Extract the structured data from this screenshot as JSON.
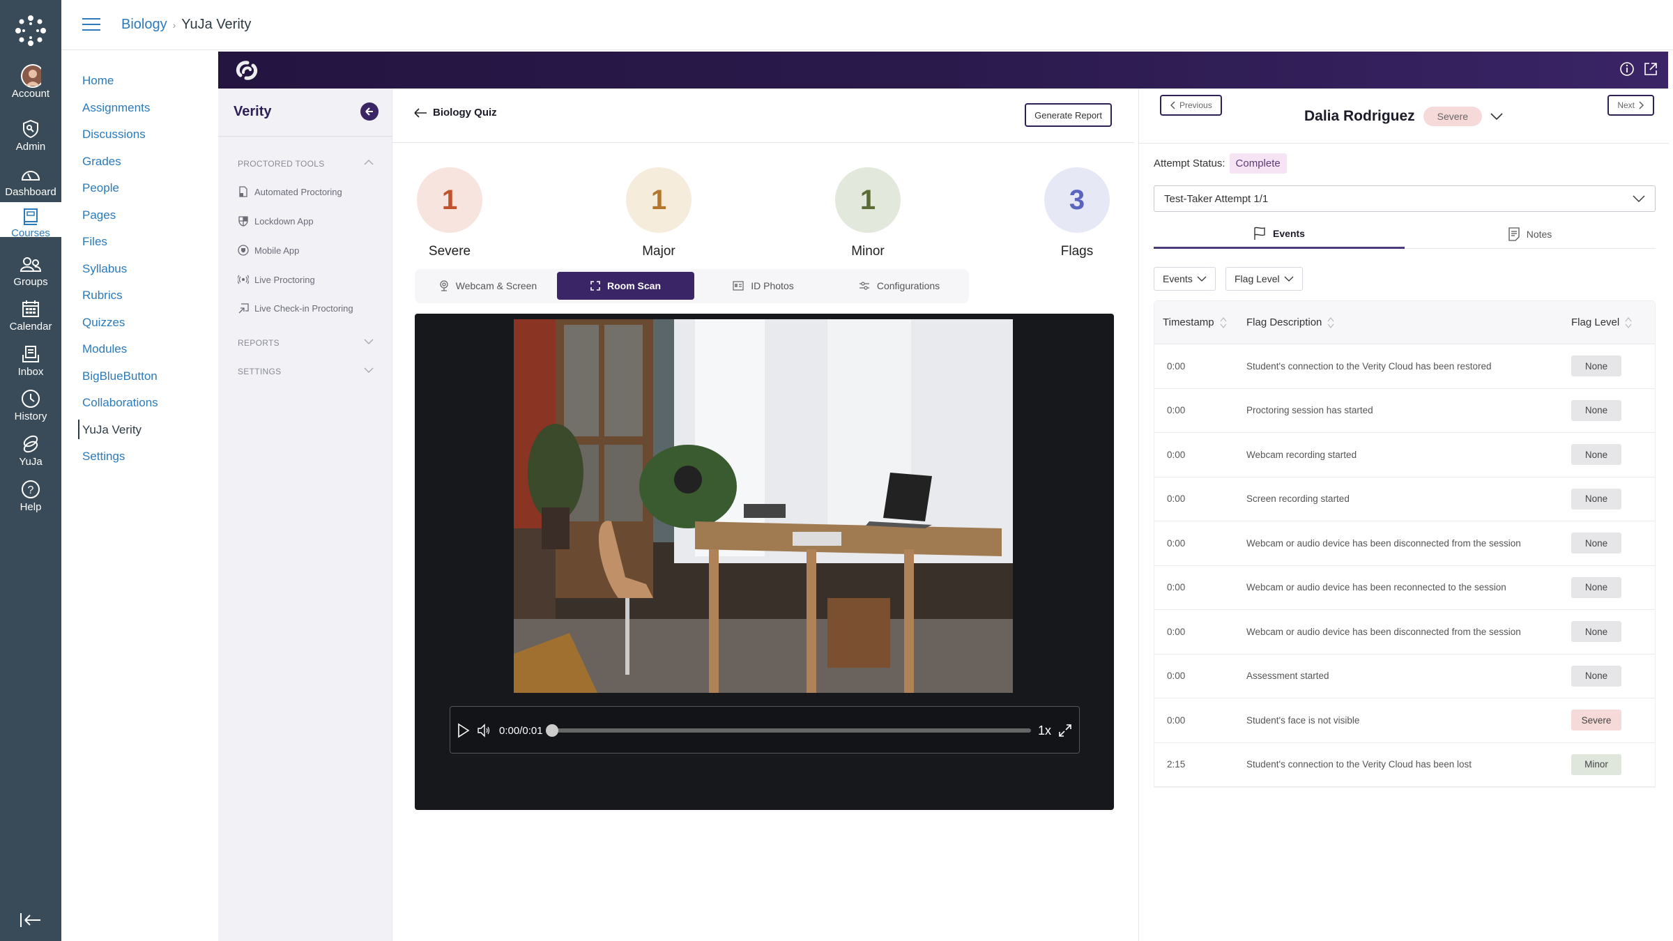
{
  "global_nav": {
    "items": [
      {
        "label": "Account",
        "icon": "avatar-icon"
      },
      {
        "label": "Admin",
        "icon": "shield-key-icon"
      },
      {
        "label": "Dashboard",
        "icon": "dashboard-gauge-icon"
      },
      {
        "label": "Courses",
        "icon": "book-icon",
        "active": true
      },
      {
        "label": "Groups",
        "icon": "groups-icon"
      },
      {
        "label": "Calendar",
        "icon": "calendar-icon"
      },
      {
        "label": "Inbox",
        "icon": "inbox-icon"
      },
      {
        "label": "History",
        "icon": "clock-icon"
      },
      {
        "label": "YuJa",
        "icon": "yuja-icon"
      },
      {
        "label": "Help",
        "icon": "help-icon"
      }
    ]
  },
  "breadcrumb": {
    "course": "Biology",
    "separator": "›",
    "current": "YuJa Verity"
  },
  "course_nav": {
    "items": [
      "Home",
      "Assignments",
      "Discussions",
      "Grades",
      "People",
      "Pages",
      "Files",
      "Syllabus",
      "Rubrics",
      "Quizzes",
      "Modules",
      "BigBlueButton",
      "Collaborations",
      "YuJa Verity",
      "Settings"
    ],
    "active": "YuJa Verity"
  },
  "verity_sidebar": {
    "title": "Verity",
    "sections": {
      "proctored_tools": "PROCTORED TOOLS",
      "reports": "REPORTS",
      "settings": "SETTINGS"
    },
    "tools": [
      "Automated Proctoring",
      "Lockdown App",
      "Mobile App",
      "Live Proctoring",
      "Live Check-in Proctoring"
    ]
  },
  "main": {
    "back_label": "Biology Quiz",
    "generate_report": "Generate Report",
    "stats": [
      {
        "value": "1",
        "label": "Severe",
        "bg": "#f8e4de",
        "fg": "#c0532c"
      },
      {
        "value": "1",
        "label": "Major",
        "bg": "#f5ecdc",
        "fg": "#b4762a"
      },
      {
        "value": "1",
        "label": "Minor",
        "bg": "#e2e8dc",
        "fg": "#5a6b36"
      },
      {
        "value": "3",
        "label": "Flags",
        "bg": "#e6e8f6",
        "fg": "#5a64c0"
      }
    ],
    "tabs": [
      "Webcam & Screen",
      "Room Scan",
      "ID Photos",
      "Configurations"
    ],
    "active_tab": "Room Scan",
    "player": {
      "time": "0:00/0:01",
      "speed": "1x",
      "progress": 0
    }
  },
  "right_panel": {
    "previous": "Previous",
    "next": "Next",
    "student_name": "Dalia Rodriguez",
    "student_level": "Severe",
    "attempt_status_label": "Attempt Status:",
    "attempt_status": "Complete",
    "attempt_select": "Test-Taker Attempt 1/1",
    "tabs": [
      "Events",
      "Notes"
    ],
    "active_tab": "Events",
    "filters": [
      "Events",
      "Flag Level"
    ],
    "table": {
      "headers": [
        "Timestamp",
        "Flag Description",
        "Flag Level"
      ],
      "rows": [
        {
          "time": "0:00",
          "desc": "Student's connection to the Verity Cloud has been restored",
          "level": "None"
        },
        {
          "time": "0:00",
          "desc": "Proctoring session has started",
          "level": "None"
        },
        {
          "time": "0:00",
          "desc": "Webcam recording started",
          "level": "None"
        },
        {
          "time": "0:00",
          "desc": "Screen recording started",
          "level": "None"
        },
        {
          "time": "0:00",
          "desc": "Webcam or audio device has been disconnected from the session",
          "level": "None"
        },
        {
          "time": "0:00",
          "desc": "Webcam or audio device has been reconnected to the session",
          "level": "None"
        },
        {
          "time": "0:00",
          "desc": "Webcam or audio device has been disconnected from the session",
          "level": "None"
        },
        {
          "time": "0:00",
          "desc": "Assessment started",
          "level": "None"
        },
        {
          "time": "0:00",
          "desc": "Student's face is not visible",
          "level": "Severe"
        },
        {
          "time": "2:15",
          "desc": "Student's connection to the Verity Cloud has been lost",
          "level": "Minor"
        }
      ]
    },
    "level_colors": {
      "None": "#e6e6e8",
      "Severe": "#f6dada",
      "Minor": "#dfe6dc"
    }
  }
}
